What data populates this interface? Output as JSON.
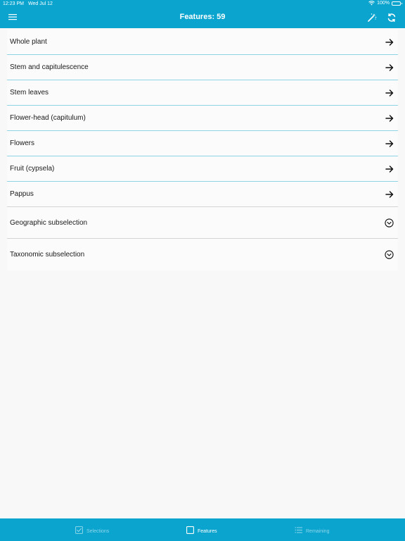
{
  "status": {
    "time": "12:23 PM",
    "date": "Wed Jul 12",
    "battery": "100%"
  },
  "header": {
    "title": "Features: 59",
    "color": "#0aa4cf"
  },
  "list": {
    "items": [
      {
        "label": "Whole plant",
        "icon": "arrow-right-icon"
      },
      {
        "label": "Stem and capitulescence",
        "icon": "arrow-right-icon"
      },
      {
        "label": "Stem leaves",
        "icon": "arrow-right-icon"
      },
      {
        "label": "Flower-head (capitulum)",
        "icon": "arrow-right-icon"
      },
      {
        "label": "Flowers",
        "icon": "arrow-right-icon"
      },
      {
        "label": "Fruit (cypsela)",
        "icon": "arrow-right-icon"
      },
      {
        "label": "Pappus",
        "icon": "arrow-right-icon"
      },
      {
        "label": "Geographic subselection",
        "icon": "chevron-down-circle-icon"
      },
      {
        "label": "Taxonomic subselection",
        "icon": "chevron-down-circle-icon"
      }
    ]
  },
  "tabbar": {
    "tabs": [
      {
        "label": "Selections",
        "icon": "checkbox-icon",
        "active": false
      },
      {
        "label": "Features",
        "icon": "square-icon",
        "active": true
      },
      {
        "label": "Remaining",
        "icon": "list-icon",
        "active": false
      }
    ]
  }
}
